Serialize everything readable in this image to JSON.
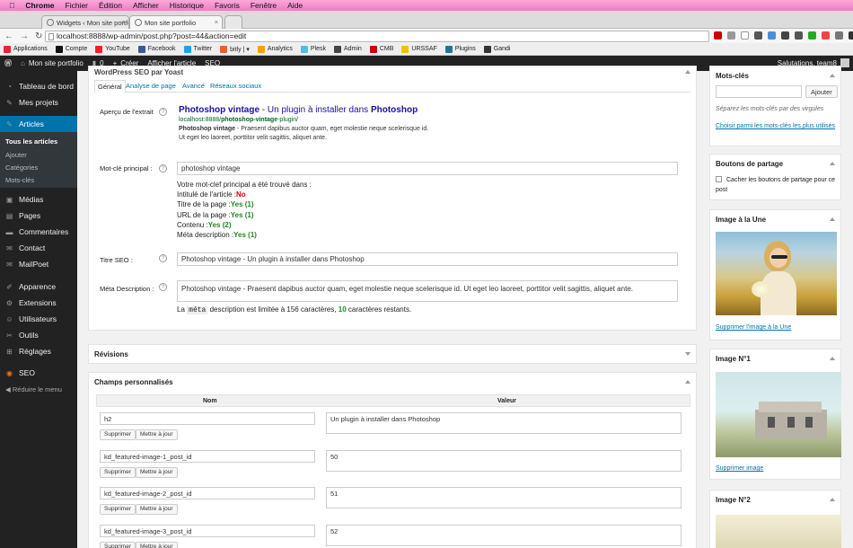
{
  "mac": {
    "apple": "",
    "app": "Chrome",
    "menus": [
      "Fichier",
      "Édition",
      "Afficher",
      "Historique",
      "Favoris",
      "Fenêtre",
      "Aide"
    ]
  },
  "tabs": [
    {
      "label": "Widgets ‹ Mon site portfolio"
    },
    {
      "label": "Mon site portfolio"
    }
  ],
  "url": "localhost:8888/wp-admin/post.php?post=44&action=edit",
  "bookmarks": [
    {
      "label": "Applications",
      "color": "#e23"
    },
    {
      "label": "Compte",
      "color": "#111"
    },
    {
      "label": "YouTube",
      "color": "#e22"
    },
    {
      "label": "Facebook",
      "color": "#3b5998"
    },
    {
      "label": "Twitter",
      "color": "#1da1f2"
    },
    {
      "label": "bitly | ▾",
      "color": "#ee6123"
    },
    {
      "label": "Analytics",
      "color": "#f4a300"
    },
    {
      "label": "Plesk",
      "color": "#52bbe6"
    },
    {
      "label": "Admin",
      "color": "#444"
    },
    {
      "label": "CMB",
      "color": "#c00"
    },
    {
      "label": "URSSAF",
      "color": "#f2c200"
    },
    {
      "label": "Plugins",
      "color": "#21759b"
    },
    {
      "label": "Gandi",
      "color": "#333"
    }
  ],
  "adminbar": {
    "site": "Mon site portfolio",
    "comments": "0",
    "new": "Créer",
    "view": "Afficher l'article",
    "seo": "SEO",
    "greeting": "Salutations, team8"
  },
  "sidebar": {
    "items": [
      {
        "label": "Tableau de bord",
        "icon": "dashboard-icon"
      },
      {
        "label": "Mes projets",
        "icon": "pin-icon"
      },
      {
        "label": "Articles",
        "icon": "pin-icon"
      },
      {
        "label": "Médias",
        "icon": "media-icon"
      },
      {
        "label": "Pages",
        "icon": "page-icon"
      },
      {
        "label": "Commentaires",
        "icon": "comment-icon"
      },
      {
        "label": "Contact",
        "icon": "contact-icon"
      },
      {
        "label": "MailPoet",
        "icon": "mail-icon"
      },
      {
        "label": "Apparence",
        "icon": "brush-icon"
      },
      {
        "label": "Extensions",
        "icon": "plugin-icon"
      },
      {
        "label": "Utilisateurs",
        "icon": "users-icon"
      },
      {
        "label": "Outils",
        "icon": "tools-icon"
      },
      {
        "label": "Réglages",
        "icon": "settings-icon"
      },
      {
        "label": "SEO",
        "icon": "seo-icon"
      }
    ],
    "sub": [
      "Tous les articles",
      "Ajouter",
      "Catégories",
      "Mots-clés"
    ],
    "collapse": "Réduire le menu"
  },
  "seo": {
    "title": "WordPress SEO par Yoast",
    "tabs": [
      "Général",
      "Analyse de page",
      "Avancé",
      "Réseaux sociaux"
    ],
    "snippet_label": "Aperçu de l'extrait",
    "snippet_title_a": "Photoshop vintage",
    "snippet_title_b": " - Un plugin à installer dans ",
    "snippet_title_c": "Photoshop",
    "snippet_url_a": "localhost:8888/",
    "snippet_url_b": "photoshop-vintage",
    "snippet_url_c": "-plugin/",
    "snippet_desc_a": "Photoshop vintage",
    "snippet_desc_b": " - Praesent dapibus auctor quam, eget molestie neque scelerisque id.",
    "snippet_desc_c": "Ut eget leo laoreet, porttitor velit sagittis, aliquet ante.",
    "focus_label": "Mot-clé principal :",
    "focus_value": "photoshop vintage",
    "found_intro": "Votre mot-clef principal a été trouvé dans :",
    "checks": [
      {
        "label": "Intitulé de l'article :",
        "value": "No",
        "ok": false
      },
      {
        "label": "Titre de la page :",
        "value": "Yes (1)",
        "ok": true
      },
      {
        "label": "URL de la page :",
        "value": "Yes (1)",
        "ok": true
      },
      {
        "label": "Contenu :",
        "value": "Yes (2)",
        "ok": true
      },
      {
        "label": "Méta description :",
        "value": "Yes (1)",
        "ok": true
      }
    ],
    "seotitle_label": "Titre SEO :",
    "seotitle_value": "Photoshop vintage - Un plugin à installer dans Photoshop",
    "meta_label": "Méta Description :",
    "meta_value": "Photoshop vintage - Praesent dapibus auctor quam, eget molestie neque scelerisque id. Ut eget leo laoreet, porttitor velit sagittis, aliquet ante.",
    "meta_note_a": "La",
    "meta_note_code": "méta",
    "meta_note_b": "description est limitée à 156 caractères,",
    "meta_note_count": "10",
    "meta_note_c": "caractères restants."
  },
  "revisions": {
    "title": "Révisions"
  },
  "custom": {
    "title": "Champs personnalisés",
    "col_name": "Nom",
    "col_value": "Valeur",
    "delete": "Supprimer",
    "update": "Mettre à jour",
    "rows": [
      {
        "name": "h2",
        "value": "Un plugin à installer dans Photoshop"
      },
      {
        "name": "kd_featured-image-1_post_id",
        "value": "50"
      },
      {
        "name": "kd_featured-image-2_post_id",
        "value": "51"
      },
      {
        "name": "kd_featured-image-3_post_id",
        "value": "52"
      }
    ]
  },
  "tagsbox": {
    "title": "Mots-clés",
    "add": "Ajouter",
    "hint": "Séparez les mots-clés par des virgules",
    "choose": "Choisir parmi les mots-clés les plus utilisés"
  },
  "share": {
    "title": "Boutons de partage",
    "checkbox": "Cacher les boutons de partage pour ce post"
  },
  "featured": {
    "title": "Image à la Une",
    "remove": "Supprimer l'image à la Une"
  },
  "img1": {
    "title": "Image N°1",
    "remove": "Supprimer image"
  },
  "img2": {
    "title": "Image N°2"
  }
}
